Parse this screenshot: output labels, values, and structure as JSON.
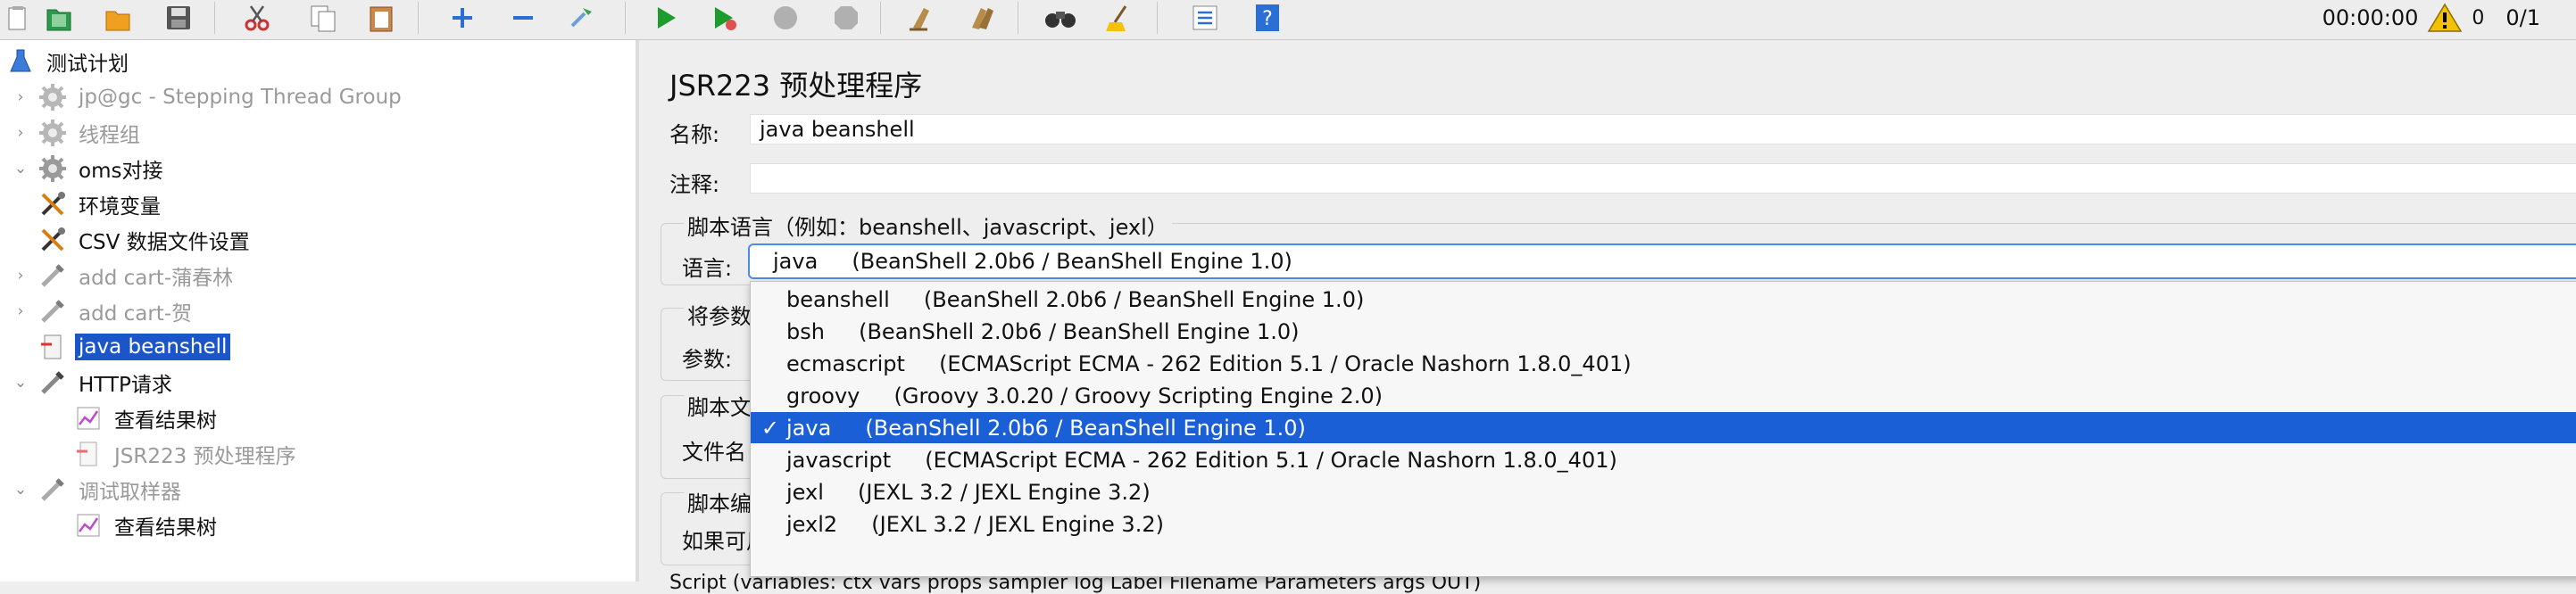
{
  "toolbar": {
    "buttons": [
      {
        "name": "templates-icon"
      },
      {
        "name": "open-icon"
      },
      {
        "name": "save-icon"
      },
      {
        "name": "cut-icon"
      },
      {
        "name": "copy-icon"
      },
      {
        "name": "paste-icon"
      },
      {
        "name": "expand-icon"
      },
      {
        "name": "collapse-icon"
      },
      {
        "name": "toggle-icon"
      },
      {
        "name": "start-icon"
      },
      {
        "name": "start-no-pause-icon"
      },
      {
        "name": "stop-icon"
      },
      {
        "name": "shutdown-icon"
      },
      {
        "name": "clear-icon"
      },
      {
        "name": "clear-all-icon"
      },
      {
        "name": "search-icon"
      },
      {
        "name": "reset-search-icon"
      },
      {
        "name": "function-helper-icon"
      },
      {
        "name": "help-icon"
      }
    ],
    "timer": "00:00:00",
    "warning_count": "0",
    "threads": "0/1",
    "colors": {
      "start": "#1c9c2c",
      "warning": "#f2c200",
      "help": "#2a6fd6"
    }
  },
  "tree": {
    "items": [
      {
        "label": "测试计划",
        "icon": "flask-icon",
        "arrow": "",
        "indent": 0,
        "disabled": false,
        "selected": false
      },
      {
        "label": "jp@gc - Stepping Thread Group",
        "icon": "gear-icon",
        "arrow": "›",
        "indent": 1,
        "disabled": true,
        "selected": false
      },
      {
        "label": "线程组",
        "icon": "gear-icon",
        "arrow": "›",
        "indent": 1,
        "disabled": true,
        "selected": false
      },
      {
        "label": "oms对接",
        "icon": "gear-icon",
        "arrow": "⌄",
        "indent": 1,
        "disabled": false,
        "selected": false
      },
      {
        "label": "环境变量",
        "icon": "tools-icon",
        "arrow": "",
        "indent": 2,
        "disabled": false,
        "selected": false
      },
      {
        "label": "CSV 数据文件设置",
        "icon": "tools-icon",
        "arrow": "",
        "indent": 2,
        "disabled": false,
        "selected": false
      },
      {
        "label": "add cart-蒲春林",
        "icon": "pipette-icon",
        "arrow": "›",
        "indent": 2,
        "disabled": true,
        "selected": false
      },
      {
        "label": "add cart-贺",
        "icon": "pipette-icon",
        "arrow": "›",
        "indent": 2,
        "disabled": true,
        "selected": false
      },
      {
        "label": "java beanshell",
        "icon": "preprocessor-icon",
        "arrow": "",
        "indent": 2,
        "disabled": false,
        "selected": true
      },
      {
        "label": "HTTP请求",
        "icon": "pipette-icon",
        "arrow": "⌄",
        "indent": 2,
        "disabled": false,
        "selected": false
      },
      {
        "label": "查看结果树",
        "icon": "chart-icon",
        "arrow": "",
        "indent": 3,
        "disabled": false,
        "selected": false
      },
      {
        "label": "JSR223 预处理程序",
        "icon": "preprocessor-icon",
        "arrow": "",
        "indent": 3,
        "disabled": true,
        "selected": false
      },
      {
        "label": "调试取样器",
        "icon": "pipette-icon",
        "arrow": "⌄",
        "indent": 2,
        "disabled": true,
        "selected": false
      },
      {
        "label": "查看结果树",
        "icon": "chart-icon",
        "arrow": "",
        "indent": 3,
        "disabled": false,
        "selected": false
      }
    ]
  },
  "panel": {
    "title": "JSR223 预处理程序",
    "name_label": "名称:",
    "name_value": "java beanshell",
    "comment_label": "注释:",
    "comment_value": "",
    "script_lang_group": "脚本语言（例如：beanshell、javascript、jexl）",
    "lang_label": "语言:",
    "lang_selected": "java     (BeanShell 2.0b6 / BeanShell Engine 1.0)",
    "params_group": "将参数",
    "params_label": "参数:",
    "script_file_group": "脚本文",
    "file_name_label": "文件名",
    "compile_group": "脚本编",
    "cache_label": "如果可用，缓存编译脚本:",
    "script_line": "Script (variables: ctx vars props sampler log Label Filename Parameters args OUT)"
  },
  "dropdown": {
    "options": [
      {
        "label": "beanshell     (BeanShell 2.0b6 / BeanShell Engine 1.0)",
        "check": ""
      },
      {
        "label": "bsh     (BeanShell 2.0b6 / BeanShell Engine 1.0)",
        "check": ""
      },
      {
        "label": "ecmascript     (ECMAScript ECMA - 262 Edition 5.1 / Oracle Nashorn 1.8.0_401)",
        "check": ""
      },
      {
        "label": "groovy     (Groovy 3.0.20 / Groovy Scripting Engine 2.0)",
        "check": ""
      },
      {
        "label": "java     (BeanShell 2.0b6 / BeanShell Engine 1.0)",
        "check": "✓"
      },
      {
        "label": "javascript     (ECMAScript ECMA - 262 Edition 5.1 / Oracle Nashorn 1.8.0_401)",
        "check": ""
      },
      {
        "label": "jexl     (JEXL 3.2 / JEXL Engine 3.2)",
        "check": ""
      },
      {
        "label": "jexl2     (JEXL 3.2 / JEXL Engine 3.2)",
        "check": ""
      }
    ],
    "selected_index": 4
  }
}
